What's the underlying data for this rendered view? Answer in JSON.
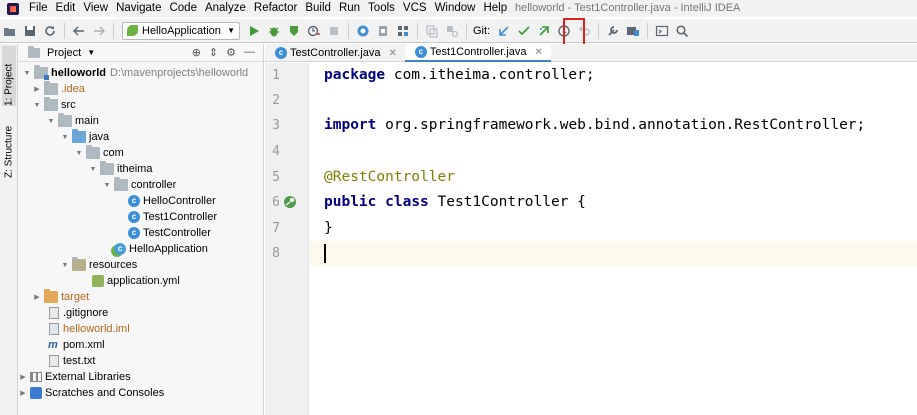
{
  "window": {
    "title": "helloworld - Test1Controller.java - IntelliJ IDEA"
  },
  "menu": [
    "File",
    "Edit",
    "View",
    "Navigate",
    "Code",
    "Analyze",
    "Refactor",
    "Build",
    "Run",
    "Tools",
    "VCS",
    "Window",
    "Help"
  ],
  "toolbar": {
    "run_config": "HelloApplication",
    "git_label": "Git:"
  },
  "left_strip": {
    "project_tab": "1: Project",
    "structure_tab": "Z: Structure"
  },
  "project_panel": {
    "title": "Project",
    "tree": [
      {
        "label": "helloworld",
        "note": "D:\\mavenprojects\\helloworld"
      },
      {
        "label": ".idea"
      },
      {
        "label": "src"
      },
      {
        "label": "main"
      },
      {
        "label": "java"
      },
      {
        "label": "com"
      },
      {
        "label": "itheima"
      },
      {
        "label": "controller"
      },
      {
        "label": "HelloController"
      },
      {
        "label": "Test1Controller"
      },
      {
        "label": "TestController"
      },
      {
        "label": "HelloApplication"
      },
      {
        "label": "resources"
      },
      {
        "label": "application.yml"
      },
      {
        "label": "target"
      },
      {
        "label": ".gitignore"
      },
      {
        "label": "helloworld.iml"
      },
      {
        "label": "pom.xml"
      },
      {
        "label": "test.txt"
      },
      {
        "label": "External Libraries"
      },
      {
        "label": "Scratches and Consoles"
      }
    ]
  },
  "editor": {
    "tabs": [
      {
        "label": "TestController.java"
      },
      {
        "label": "Test1Controller.java"
      }
    ],
    "line_numbers": [
      "1",
      "2",
      "3",
      "4",
      "5",
      "6",
      "7",
      "8"
    ],
    "code": {
      "line1_kw": "package",
      "line1_rest": " com.itheima.controller;",
      "line3_kw": "import",
      "line3_rest": " org.springframework.web.bind.annotation.RestController;",
      "line5_ann": "@RestController",
      "line6_kw1": "public",
      "line6_kw2": "class",
      "line6_rest": " Test1Controller {",
      "line7": "}"
    }
  }
}
